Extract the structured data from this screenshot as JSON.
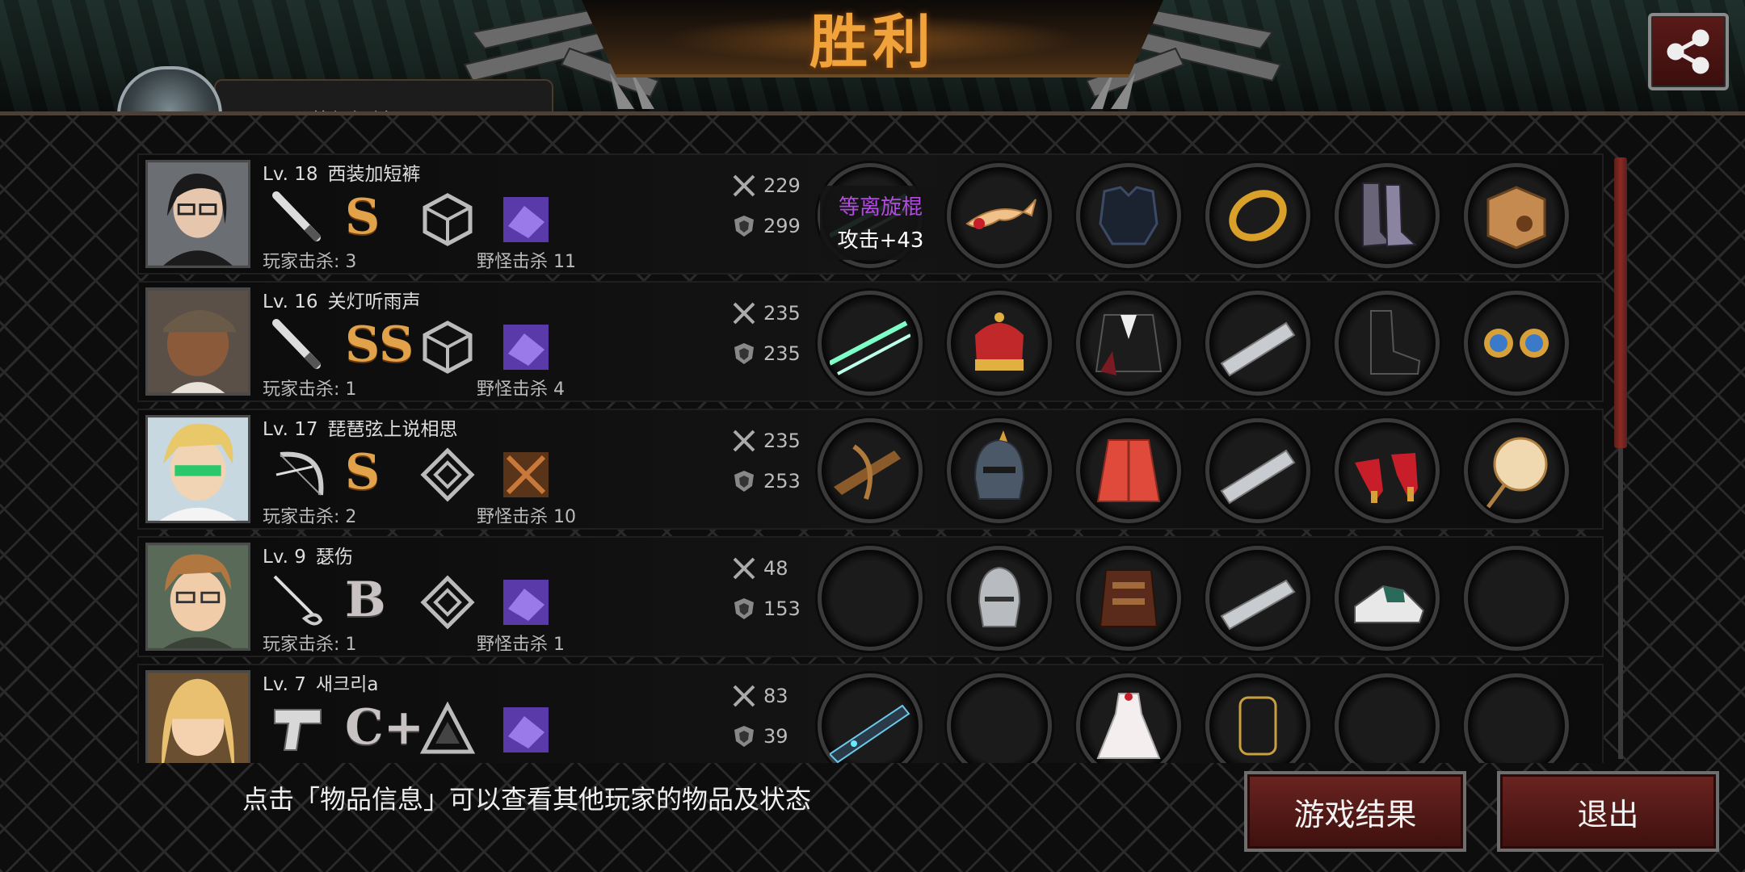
{
  "header": {
    "title": "胜利",
    "team_tab_label": "西装加短裤"
  },
  "tooltip": {
    "item_name": "等离旋棍",
    "item_stat": "攻击+43"
  },
  "players": [
    {
      "level": "Lv. 18",
      "name": "西装加短裤",
      "grade": "S",
      "player_kills": "玩家击杀: 3",
      "monster_kills": "野怪击杀 11",
      "attack": "229",
      "defense": "299",
      "weapon_icon": "baton-icon",
      "items": [
        "plasma-baton-icon",
        "winged-circlet-icon",
        "dark-armor-icon",
        "gold-bracelet-icon",
        "leather-boots-icon",
        "mystery-box-icon"
      ]
    },
    {
      "level": "Lv. 16",
      "name": "关灯听雨声",
      "grade": "SS",
      "player_kills": "玩家击杀: 1",
      "monster_kills": "野怪击杀 4",
      "attack": "235",
      "defense": "235",
      "weapon_icon": "baton-icon",
      "items": [
        "plasma-baton-icon",
        "royal-crown-icon",
        "tuxedo-icon",
        "spiked-bracer-icon",
        "combat-boots-icon",
        "gem-earrings-icon"
      ]
    },
    {
      "level": "Lv. 17",
      "name": "琵琶弦上说相思",
      "grade": "S",
      "player_kills": "玩家击杀: 2",
      "monster_kills": "野怪击杀 10",
      "attack": "235",
      "defense": "253",
      "weapon_icon": "bow-icon",
      "items": [
        "crossbow-icon",
        "knight-helmet-icon",
        "red-coat-icon",
        "spiked-bracer-icon",
        "red-heels-icon",
        "hand-fan-icon"
      ]
    },
    {
      "level": "Lv. 9",
      "name": "瑟伤",
      "grade": "B",
      "player_kills": "玩家击杀: 1",
      "monster_kills": "野怪击杀 1",
      "attack": "48",
      "defense": "153",
      "weapon_icon": "rapier-icon",
      "items": [
        "empty-slot",
        "iron-helmet-icon",
        "leather-armor-icon",
        "bracer-icon",
        "sneakers-icon",
        "empty-slot"
      ]
    },
    {
      "level": "Lv. 7",
      "name": "새크리a",
      "grade": "C+",
      "player_kills": "",
      "monster_kills": "",
      "attack": "83",
      "defense": "39",
      "weapon_icon": "pistol-icon",
      "items": [
        "laser-rifle-icon",
        "empty-slot",
        "white-dress-icon",
        "gauntlet-icon",
        "empty-slot",
        "empty-slot"
      ]
    }
  ],
  "footer": {
    "hint": "点击「物品信息」可以查看其他玩家的物品及状态",
    "result_button": "游戏结果",
    "exit_button": "退出"
  },
  "colors": {
    "accent_gold": "#f0a33a",
    "button_red": "#6a2420",
    "tooltip_purple": "#b24be0"
  }
}
